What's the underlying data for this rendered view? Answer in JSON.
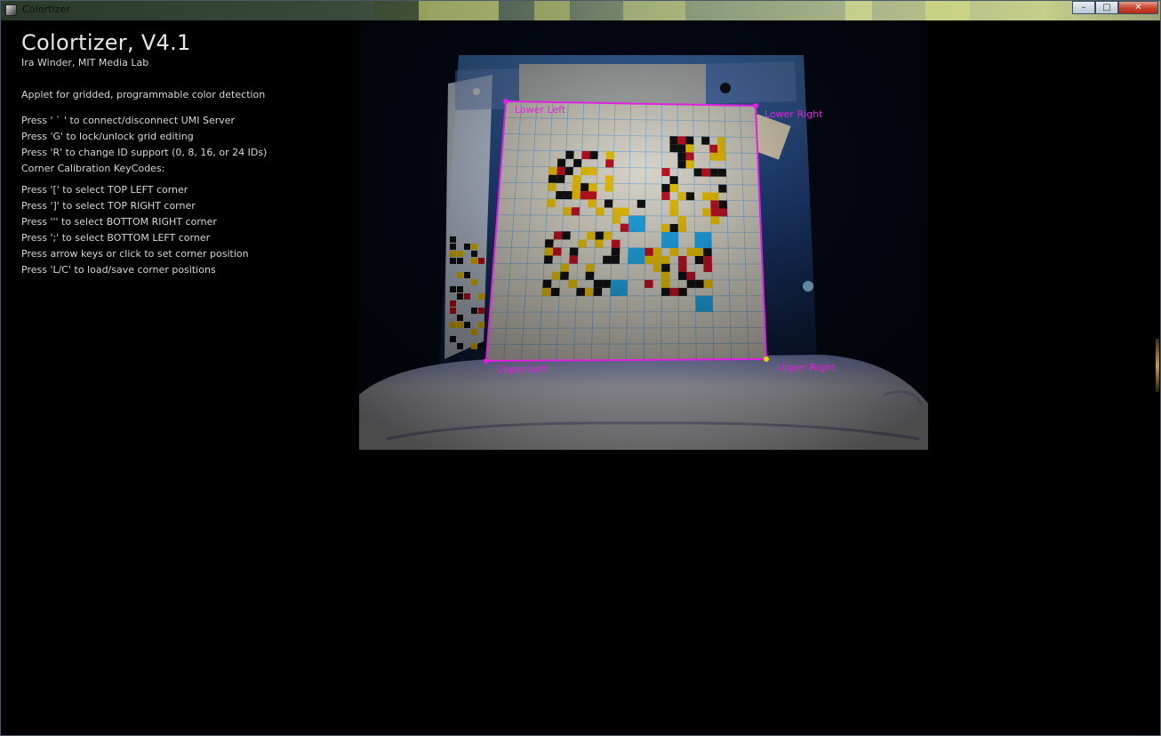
{
  "window": {
    "title": "Colortizer",
    "controls": {
      "minimize": "–",
      "maximize": "□",
      "close": "✕"
    }
  },
  "header": {
    "title": "Colortizer, V4.1",
    "author": "Ira Winder, MIT Media Lab",
    "description": "Applet for gridded, programmable color detection"
  },
  "help": {
    "general": [
      "Press ' ` ' to connect/disconnect UMI Server",
      "Press 'G' to lock/unlock grid editing",
      "Press 'R' to change ID support (0, 8, 16, or 24 IDs)",
      "Corner Calibration KeyCodes:"
    ],
    "corners": [
      "Press '[' to select TOP LEFT corner",
      "Press ']' to select TOP RIGHT corner",
      "Press ''' to select BOTTOM RIGHT corner",
      "Press ';' to select BOTTOM LEFT corner",
      "Press arrow keys or click to set corner position",
      "Press 'L/C' to load/save corner positions"
    ]
  },
  "camera": {
    "corner_labels": {
      "lower_left": "Lower Left",
      "lower_right": "Lower Right",
      "upper_left": "Upper Left",
      "upper_right": "Upper Right"
    },
    "overlay_color": "#e020e0",
    "grid_cells": 16
  },
  "colors": {
    "background": "#000000",
    "text": "#d8d8d8",
    "overlay": "#e020e0",
    "piece_black": "#111111",
    "piece_yellow": "#e8c000",
    "piece_red": "#c01020",
    "piece_cyan": "#20a8e8"
  }
}
